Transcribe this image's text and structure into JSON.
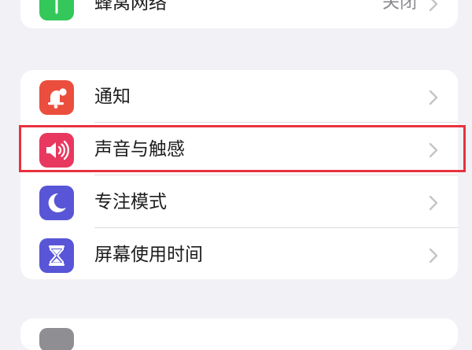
{
  "top_group": {
    "cellular": {
      "label": "蜂窝网络",
      "value": "关闭",
      "icon": "antenna-icon",
      "icon_color": "#34c759"
    }
  },
  "middle_group": {
    "items": [
      {
        "label": "通知",
        "icon": "bell-badge-icon",
        "icon_color": "#eb4e3d"
      },
      {
        "label": "声音与触感",
        "icon": "speaker-wave-icon",
        "icon_color": "#e8385f"
      },
      {
        "label": "专注模式",
        "icon": "moon-icon",
        "icon_color": "#5856d6"
      },
      {
        "label": "屏幕使用时间",
        "icon": "hourglass-icon",
        "icon_color": "#5856d6"
      }
    ]
  },
  "highlight": {
    "target": "声音与触感",
    "color": "#e8323f"
  },
  "colors": {
    "background": "#f2f2f6",
    "card": "#ffffff",
    "text": "#1c1c1e",
    "secondary_text": "#8a8a8f",
    "chevron": "#c4c4c7"
  }
}
